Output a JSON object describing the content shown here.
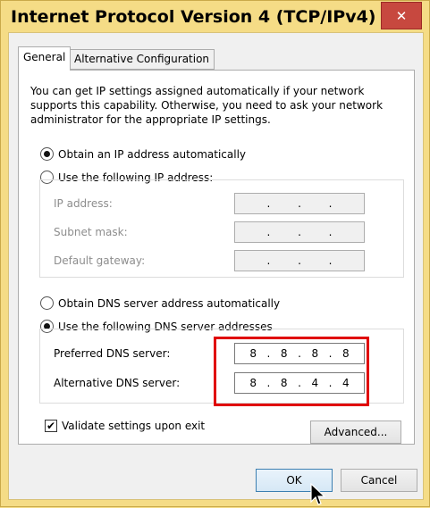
{
  "window": {
    "title": "Internet Protocol Version 4 (TCP/IPv4) ...",
    "close_glyph": "✕"
  },
  "tabs": [
    {
      "label": "General",
      "active": true
    },
    {
      "label": "Alternative Configuration",
      "active": false
    }
  ],
  "general": {
    "description": "You can get IP settings assigned automatically if your network supports this capability. Otherwise, you need to ask your network administrator for the appropriate IP settings.",
    "ip_mode": {
      "auto_label": "Obtain an IP address automatically",
      "manual_label": "Use the following IP address:",
      "selected": "auto"
    },
    "ip_fields": {
      "ip_address": {
        "label": "IP address:",
        "value": [
          ".",
          ".",
          "."
        ]
      },
      "subnet_mask": {
        "label": "Subnet mask:",
        "value": [
          ".",
          ".",
          "."
        ]
      },
      "default_gateway": {
        "label": "Default gateway:",
        "value": [
          ".",
          ".",
          "."
        ]
      }
    },
    "dns_mode": {
      "auto_label": "Obtain DNS server address automatically",
      "manual_label": "Use the following DNS server addresses",
      "selected": "manual"
    },
    "dns_fields": {
      "preferred": {
        "label": "Preferred DNS server:",
        "octets": [
          "8",
          "8",
          "8",
          "8"
        ]
      },
      "alternative": {
        "label": "Alternative DNS server:",
        "octets": [
          "8",
          "8",
          "4",
          "4"
        ]
      }
    },
    "validate": {
      "label": "Validate settings upon exit",
      "checked": true,
      "mark": "✔"
    },
    "advanced_label": "Advanced..."
  },
  "footer": {
    "ok_label": "OK",
    "cancel_label": "Cancel"
  },
  "colors": {
    "title_bar": "#f5dc86",
    "close_button": "#c7483f",
    "highlight": "#e00000"
  }
}
